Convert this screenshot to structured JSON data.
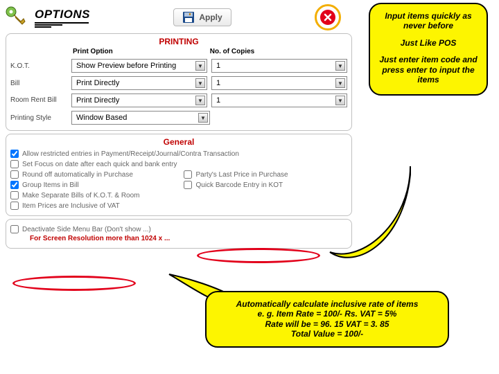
{
  "topbar": {
    "options_title": "OPTIONS",
    "apply_label": "Apply"
  },
  "printing": {
    "title": "PRINTING",
    "col1": "Print Option",
    "col2": "No. of Copies",
    "rows": [
      {
        "label": "K.O.T.",
        "option": "Show Preview before Printing",
        "copies": "1"
      },
      {
        "label": "Bill",
        "option": "Print Directly",
        "copies": "1"
      },
      {
        "label": "Room Rent Bill",
        "option": "Print Directly",
        "copies": "1"
      }
    ],
    "style_label": "Printing Style",
    "style_value": "Window Based"
  },
  "general": {
    "title": "General",
    "items": {
      "allow_restricted": "Allow restricted entries in Payment/Receipt/Journal/Contra Transaction",
      "set_focus": "Set Focus on date after each quick and bank entry",
      "round_off": "Round off automatically in Purchase",
      "party_last": "Party's Last Price in Purchase",
      "group_bill": "Group Items in Bill",
      "quick_barcode": "Quick Barcode Entry in KOT",
      "make_separate": "Make Separate Bills of K.O.T. & Room",
      "prices_incl": "Item Prices are Inclusive of VAT",
      "deactivate_side": "Deactivate Side Menu Bar (Don't show ...)",
      "screen_res": "For Screen Resolution more than 1024 x ..."
    }
  },
  "callouts": {
    "top": {
      "l1": "Input items quickly as never before",
      "l2": "Just Like POS",
      "l3": "Just enter item code and press enter to input the items"
    },
    "bottom": {
      "l1": "Automatically calculate inclusive rate of items",
      "l2": "e. g. Item Rate = 100/- Rs. VAT = 5%",
      "l3": "Rate will be = 96. 15 VAT = 3. 85",
      "l4": "Total Value = 100/-"
    }
  }
}
